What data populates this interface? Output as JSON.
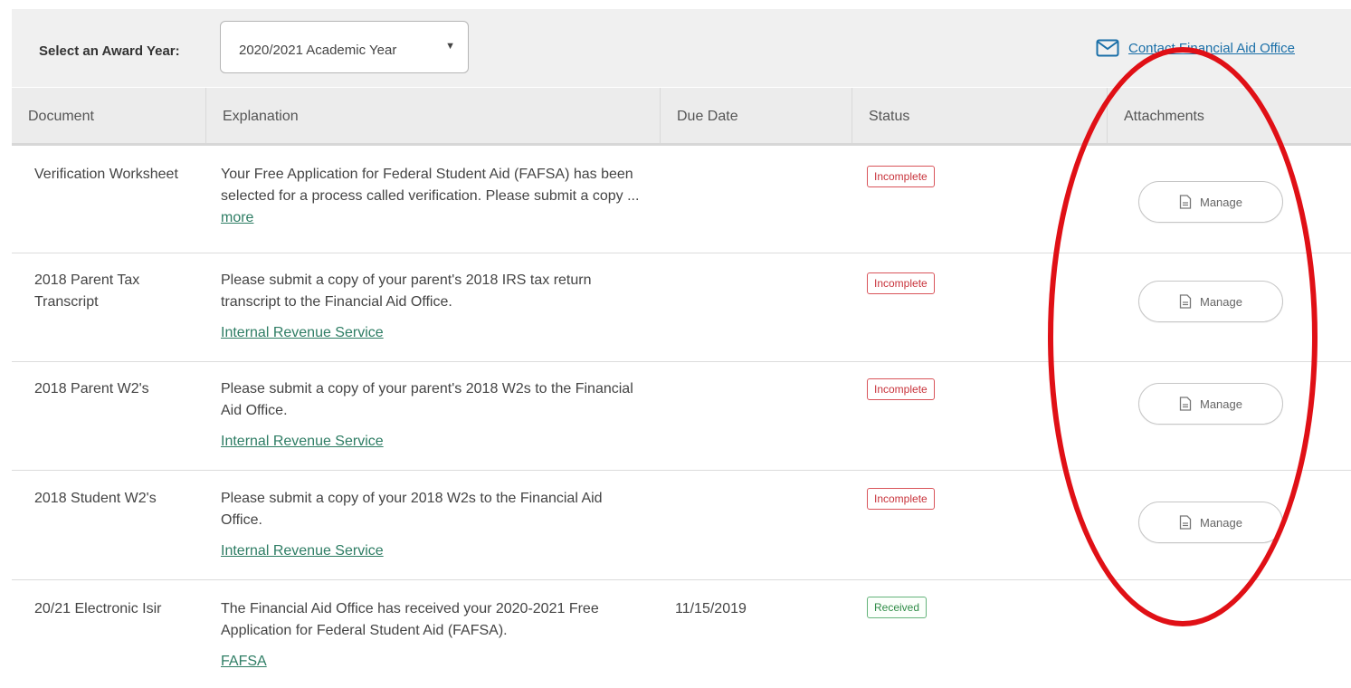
{
  "award_year": {
    "label": "Select an Award Year:",
    "selected": "2020/2021 Academic Year"
  },
  "contact": {
    "label": "Contact Financial Aid Office",
    "icon": "mail-icon"
  },
  "table": {
    "headers": [
      "Document",
      "Explanation",
      "Due Date",
      "Status",
      "Attachments"
    ],
    "rows": [
      {
        "document": "Verification Worksheet",
        "explanation": "Your Free Application for Federal Student Aid (FAFSA) has been selected for a process called verification. Please submit a copy ...",
        "link": "more",
        "due_date": "",
        "status": "Incomplete",
        "attachment": "Manage"
      },
      {
        "document": "2018 Parent Tax Transcript",
        "explanation": "Please submit a copy of your parent's 2018 IRS tax return transcript to the Financial Aid Office.",
        "link": "Internal Revenue Service",
        "due_date": "",
        "status": "Incomplete",
        "attachment": "Manage"
      },
      {
        "document": "2018 Parent W2's",
        "explanation": "Please submit a copy of your parent's 2018 W2s to the Financial Aid Office.",
        "link": "Internal Revenue Service",
        "due_date": "",
        "status": "Incomplete",
        "attachment": "Manage"
      },
      {
        "document": "2018 Student W2's",
        "explanation": "Please submit a copy of your 2018 W2s to the Financial Aid Office.",
        "link": "Internal Revenue Service",
        "due_date": "",
        "status": "Incomplete",
        "attachment": "Manage"
      },
      {
        "document": "20/21 Electronic Isir",
        "explanation": "The Financial Aid Office has received your 2020-2021 Free Application for Federal Student Aid (FAFSA).",
        "link": "FAFSA",
        "due_date": "11/15/2019",
        "status": "Received",
        "attachment": ""
      }
    ]
  },
  "colors": {
    "incomplete": "#c8333b",
    "received": "#2f8c47",
    "link": "#2e7d64",
    "highlight_oval": "#e01016"
  }
}
